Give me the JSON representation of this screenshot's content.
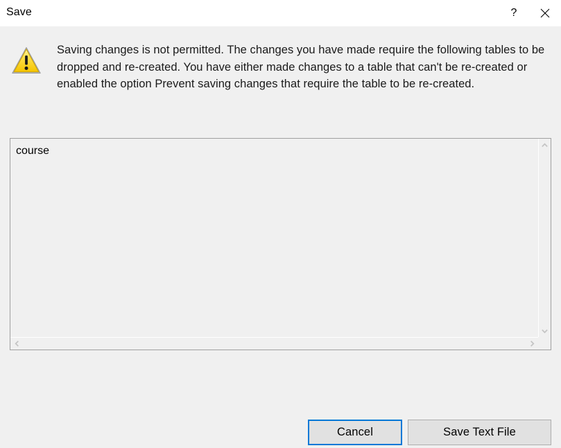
{
  "window": {
    "title": "Save",
    "background_color": "#f0f0f0",
    "titlebar_color": "#ffffff"
  },
  "titlebar": {
    "help_glyph": "?",
    "help_icon_name": "help-question-icon",
    "close_glyph": "✕",
    "close_icon_name": "close-icon"
  },
  "message": {
    "icon_name": "warning-triangle-icon",
    "icon_color": "#ffd400",
    "text": "Saving changes is not permitted. The changes you have made require the following tables to be dropped and re-created. You have either made changes to a table that can't be re-created or enabled the option Prevent saving changes that require the table to be re-created."
  },
  "listbox": {
    "lines": [
      "course"
    ],
    "value": "course",
    "vertical_scrollbar": {
      "up_arrow_icon": "chevron-up-icon",
      "down_arrow_icon": "chevron-down-icon"
    },
    "horizontal_scrollbar": {
      "left_arrow_icon": "chevron-left-icon",
      "right_arrow_icon": "chevron-right-icon"
    }
  },
  "buttons": {
    "cancel_label": "Cancel",
    "save_text_file_label": "Save Text File",
    "focus_color": "#0078d7"
  }
}
